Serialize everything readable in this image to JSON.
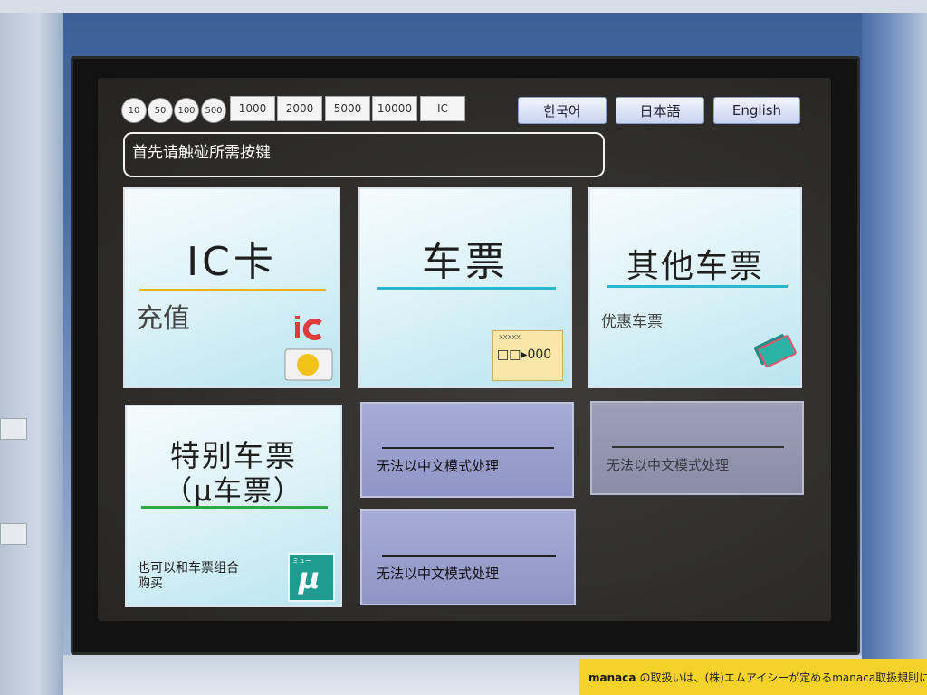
{
  "coins": [
    "10",
    "50",
    "100",
    "500"
  ],
  "notes": [
    "1000",
    "2000",
    "5000",
    "10000",
    "IC"
  ],
  "languages": [
    "한국어",
    "日本語",
    "English"
  ],
  "prompt": "首先请触碰所需按键",
  "tiles": {
    "ic_card": {
      "title": "IC卡",
      "subtitle": "充值",
      "icons": [
        "ic-logo-icon",
        "ic-card-icon"
      ]
    },
    "ticket": {
      "title": "车票",
      "ticket_top": "XXXXX",
      "ticket_text": "□□▸000",
      "icons": [
        "ticket-icon"
      ]
    },
    "other_ticket": {
      "title": "其他车票",
      "subtitle": "优惠车票",
      "icons": [
        "coupon-ticket-icon"
      ]
    },
    "special_ticket": {
      "title_line1": "特别车票",
      "title_line2": "（μ车票）",
      "subtitle_line1": "也可以和车票组合",
      "subtitle_line2": "购买",
      "logo_top": "ミュー",
      "logo_mark": "μ"
    }
  },
  "unavailable_label": "无法以中文模式处理",
  "notice": {
    "brand": "manaca",
    "text": "の取扱いは、(株)エムアイシーが定めるmanaca取扱規則によります"
  },
  "colors": {
    "ic_rule": "#e8b41b",
    "ticket_rule": "#29b6cf",
    "other_rule": "#29b6cf",
    "special_rule": "#2fa84a",
    "notice_bg": "#f5d229"
  }
}
